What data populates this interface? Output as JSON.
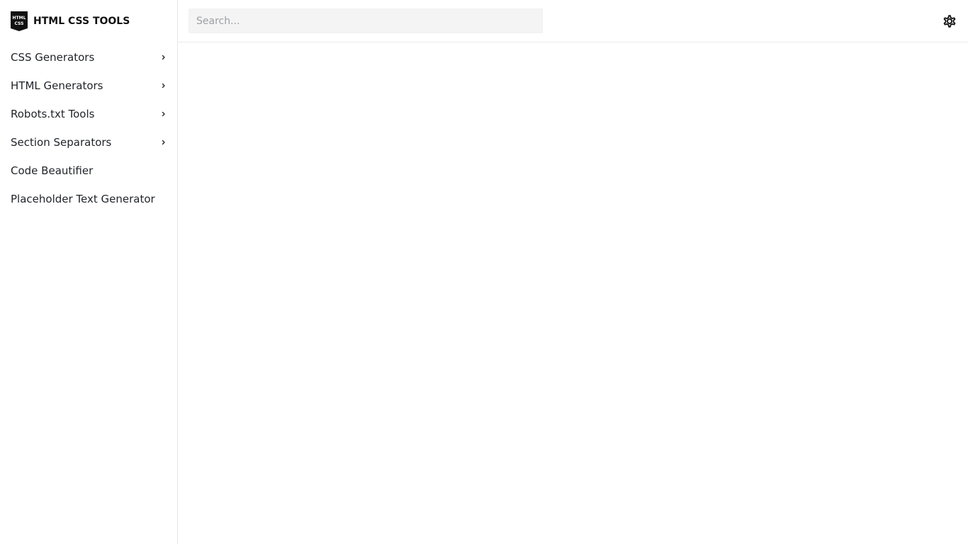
{
  "brand": {
    "logo_text_top": "HTML",
    "logo_text_bottom": "CSS",
    "title": "HTML CSS TOOLS"
  },
  "search": {
    "placeholder": "Search...",
    "value": ""
  },
  "sidebar": {
    "items": [
      {
        "label": "CSS Generators",
        "has_submenu": true
      },
      {
        "label": "HTML Generators",
        "has_submenu": true
      },
      {
        "label": "Robots.txt Tools",
        "has_submenu": true
      },
      {
        "label": "Section Separators",
        "has_submenu": true
      },
      {
        "label": "Code Beautifier",
        "has_submenu": false
      },
      {
        "label": "Placeholder Text Generator",
        "has_submenu": false
      }
    ]
  },
  "icons": {
    "chevron": "chevron-right-icon",
    "settings": "gear-icon"
  },
  "colors": {
    "text": "#1f2328",
    "search_bg": "#f4f4f4",
    "divider": "#e6e6e6",
    "logo_bg": "#111111"
  }
}
